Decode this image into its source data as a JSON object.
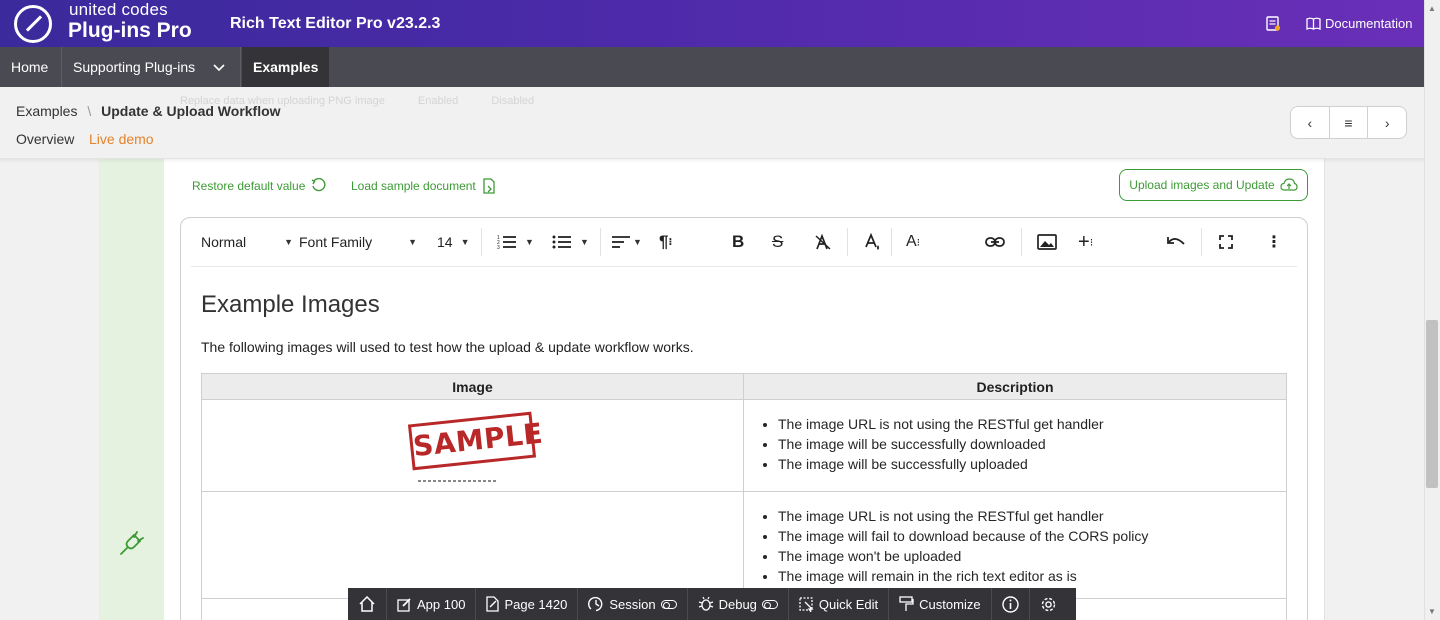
{
  "header": {
    "brand_top": "united codes",
    "brand_main": "Plug-ins Pro",
    "app_title": "Rich Text Editor Pro v23.2.3",
    "docs_label": "Documentation"
  },
  "nav": {
    "items": [
      {
        "label": "Home"
      },
      {
        "label": "Supporting Plug-ins"
      },
      {
        "label": "Examples"
      }
    ]
  },
  "ghost": {
    "text": "Replace data when uploading PNG image",
    "enabled": "Enabled",
    "disabled": "Disabled"
  },
  "breadcrumb": {
    "parent": "Examples",
    "separator": "\\",
    "current": "Update & Upload Workflow"
  },
  "tabs": {
    "overview": "Overview",
    "live": "Live demo"
  },
  "pager": {
    "prev": "‹",
    "list": "≡",
    "next": "›"
  },
  "actions": {
    "restore": "Restore default value",
    "load": "Load sample document",
    "upload": "Upload images and Update"
  },
  "toolbar": {
    "style": "Normal",
    "font_family": "Font Family",
    "font_size": "14"
  },
  "document": {
    "heading": "Example Images",
    "intro": "The following images will used to test how the upload & update workflow works.",
    "table": {
      "headers": [
        "Image",
        "Description"
      ],
      "rows": [
        {
          "image_text": "SAMPLE",
          "bullets": [
            "The image URL is not using the RESTful get handler",
            "The image will be successfully downloaded",
            "The image will be successfully uploaded"
          ]
        },
        {
          "image_text": "",
          "bullets": [
            "The image URL is not using the RESTful get handler",
            "The image will fail to download because of the CORS policy",
            "The image won't be uploaded",
            "The image will remain in the rich text editor as is"
          ]
        }
      ]
    }
  },
  "devbar": {
    "app": "App 100",
    "page": "Page 1420",
    "session": "Session",
    "debug": "Debug",
    "quick_edit": "Quick Edit",
    "customize": "Customize"
  },
  "colors": {
    "accent_orange": "#e5832a",
    "green": "#3d9b35",
    "header_purple": "#4b2aa8",
    "nav_gray": "#4a4a52"
  }
}
